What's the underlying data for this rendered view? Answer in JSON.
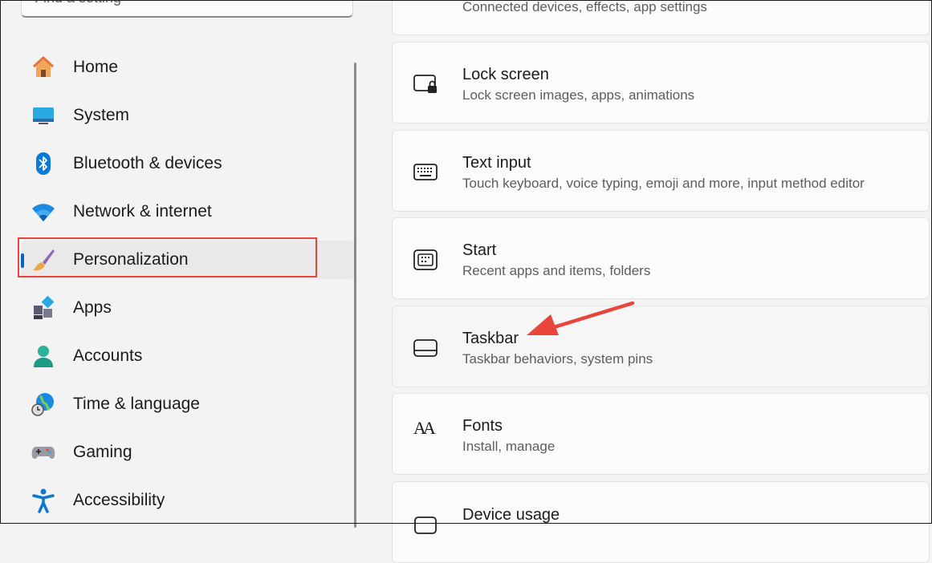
{
  "search": {
    "placeholder": "Find a setting"
  },
  "sidebar": {
    "items": [
      {
        "label": "Home",
        "icon": "home-icon"
      },
      {
        "label": "System",
        "icon": "system-icon"
      },
      {
        "label": "Bluetooth & devices",
        "icon": "bluetooth-icon"
      },
      {
        "label": "Network & internet",
        "icon": "wifi-icon"
      },
      {
        "label": "Personalization",
        "icon": "paintbrush-icon",
        "selected": true
      },
      {
        "label": "Apps",
        "icon": "apps-icon"
      },
      {
        "label": "Accounts",
        "icon": "account-icon"
      },
      {
        "label": "Time & language",
        "icon": "globe-clock-icon"
      },
      {
        "label": "Gaming",
        "icon": "gamepad-icon"
      },
      {
        "label": "Accessibility",
        "icon": "accessibility-icon"
      }
    ]
  },
  "cards": [
    {
      "title": "",
      "subtitle": "Connected devices, effects, app settings",
      "icon": "devices-icon"
    },
    {
      "title": "Lock screen",
      "subtitle": "Lock screen images, apps, animations",
      "icon": "lock-screen-icon"
    },
    {
      "title": "Text input",
      "subtitle": "Touch keyboard, voice typing, emoji and more, input method editor",
      "icon": "keyboard-icon"
    },
    {
      "title": "Start",
      "subtitle": "Recent apps and items, folders",
      "icon": "start-icon"
    },
    {
      "title": "Taskbar",
      "subtitle": "Taskbar behaviors, system pins",
      "icon": "taskbar-icon"
    },
    {
      "title": "Fonts",
      "subtitle": "Install, manage",
      "icon": "fonts-icon"
    },
    {
      "title": "Device usage",
      "subtitle": "",
      "icon": "device-usage-icon"
    }
  ],
  "fonts_icon_glyph": "AA",
  "colors": {
    "accent": "#0067c0",
    "annotation": "#e8453c"
  }
}
